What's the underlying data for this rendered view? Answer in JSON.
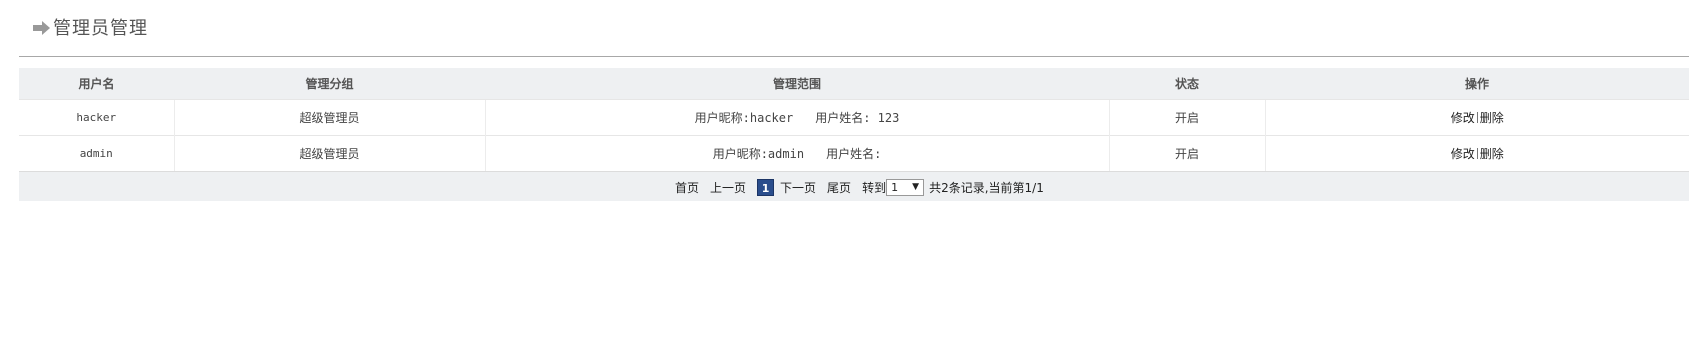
{
  "header": {
    "title": "管理员管理",
    "icon": "arrow-right-icon"
  },
  "table": {
    "columns": [
      "用户名",
      "管理分组",
      "管理范围",
      "状态",
      "操作"
    ],
    "rows": [
      {
        "username": "hacker",
        "group": "超级管理员",
        "scope_nick_label": "用户昵称:hacker",
        "scope_name_label": "用户姓名: 123",
        "status": "开启",
        "edit_label": "修改",
        "delete_label": "删除"
      },
      {
        "username": "admin",
        "group": "超级管理员",
        "scope_nick_label": "用户昵称:admin",
        "scope_name_label": "用户姓名:",
        "status": "开启",
        "edit_label": "修改",
        "delete_label": "删除"
      }
    ]
  },
  "pager": {
    "first": "首页",
    "prev": "上一页",
    "current_page": "1",
    "next": "下一页",
    "last": "尾页",
    "goto_label": "转到",
    "goto_value": "1",
    "summary": "共2条记录,当前第1/1"
  },
  "colors": {
    "header_bg": "#eef0f2",
    "current_page_bg": "#2a4d8c",
    "icon": "#999999"
  }
}
